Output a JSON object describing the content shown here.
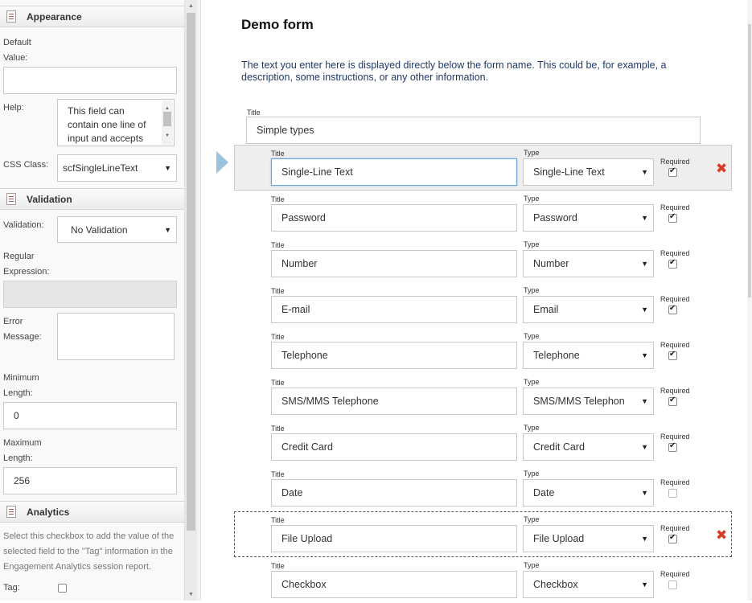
{
  "left_panel": {
    "appearance": {
      "title": "Appearance",
      "default_value_label_1": "Default",
      "default_value_label_2": "Value:",
      "default_value": "",
      "help_label": "Help:",
      "help_text": "This field can contain one line of input and accepts",
      "css_class_label": "CSS Class:",
      "css_class_value": "scfSingleLineText"
    },
    "validation": {
      "title": "Validation",
      "validation_label": "Validation:",
      "validation_value": "No Validation",
      "regex_label_1": "Regular",
      "regex_label_2": "Expression:",
      "regex_value": "",
      "error_label_1": "Error",
      "error_label_2": "Message:",
      "error_value": "",
      "min_label_1": "Minimum",
      "min_label_2": "Length:",
      "min_value": "0",
      "max_label_1": "Maximum",
      "max_label_2": "Length:",
      "max_value": "256"
    },
    "analytics": {
      "title": "Analytics",
      "help_text": "Select this checkbox to add the value of the selected field to the \"Tag\" information in the Engagement Analytics session report.",
      "tag_label": "Tag:",
      "tag_checked": false
    }
  },
  "form": {
    "title": "Demo form",
    "description": "The text you enter here is displayed directly below the form name. This could be, for example, a description, some instructions, or any other information.",
    "section_title_label": "Title",
    "section_title_value": "Simple types",
    "title_label": "Title",
    "type_label": "Type",
    "required_label": "Required",
    "fields": [
      {
        "title": "Single-Line Text",
        "type": "Single-Line Text",
        "required": true,
        "selected": true,
        "deletable": true
      },
      {
        "title": "Password",
        "type": "Password",
        "required": true
      },
      {
        "title": "Number",
        "type": "Number",
        "required": true
      },
      {
        "title": "E-mail",
        "type": "Email",
        "required": true
      },
      {
        "title": "Telephone",
        "type": "Telephone",
        "required": true
      },
      {
        "title": "SMS/MMS Telephone",
        "type": "SMS/MMS Telephon",
        "required": true
      },
      {
        "title": "Credit Card",
        "type": "Credit Card",
        "required": true
      },
      {
        "title": "Date",
        "type": "Date",
        "required": false
      },
      {
        "title": "File Upload",
        "type": "File Upload",
        "required": true,
        "dashed": true,
        "deletable": true
      },
      {
        "title": "Checkbox",
        "type": "Checkbox",
        "required": false
      }
    ]
  },
  "icons": {
    "delete": "delete-x-icon",
    "section": "document-icon",
    "indicator": "selected-arrow-icon"
  },
  "colors": {
    "delete": "#d83b2b",
    "description": "#1f3a66",
    "selection_bg": "#efedee",
    "arrow": "#9bc3de"
  }
}
